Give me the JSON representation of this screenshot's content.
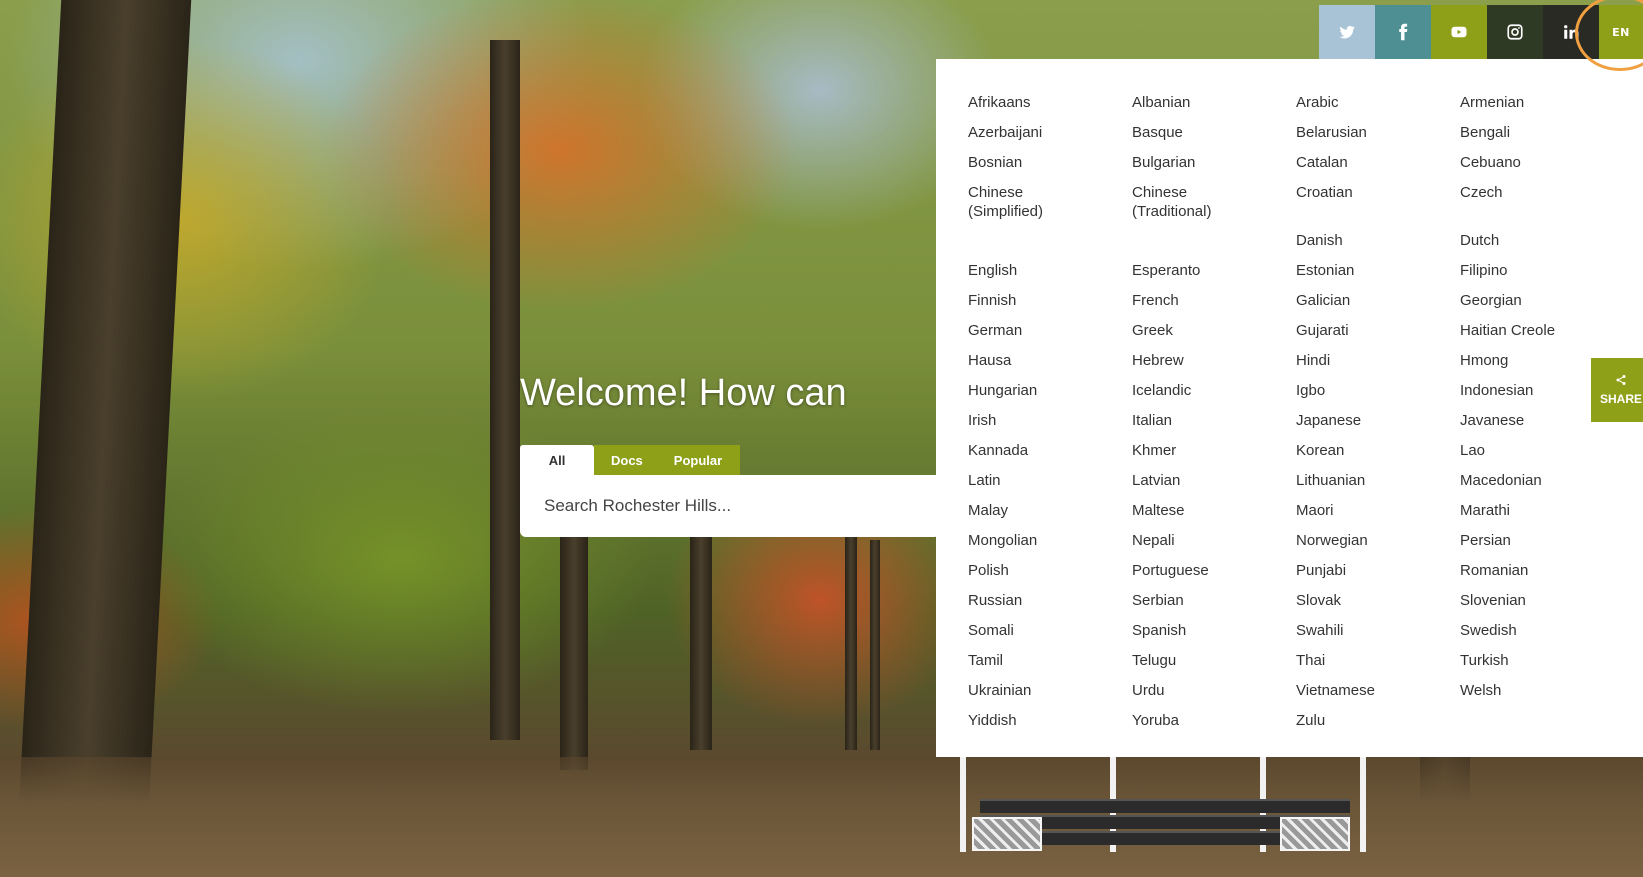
{
  "social": {
    "items": [
      {
        "name": "twitter-icon"
      },
      {
        "name": "facebook-icon"
      },
      {
        "name": "youtube-icon"
      },
      {
        "name": "instagram-icon"
      },
      {
        "name": "linkedin-icon"
      }
    ],
    "lang_button": "EN",
    "colors": {
      "accent": "#8ea018",
      "twitter": "#a9c3d6",
      "facebook": "#4e8f94",
      "highlight": "#f0a040"
    }
  },
  "hero": {
    "welcome": "Welcome! How can"
  },
  "search": {
    "tabs": [
      {
        "label": "All"
      },
      {
        "label": "Docs"
      },
      {
        "label": "Popular"
      }
    ],
    "placeholder": "Search Rochester Hills..."
  },
  "languages": [
    "Afrikaans",
    "Albanian",
    "Arabic",
    "Armenian",
    "Azerbaijani",
    "Basque",
    "Belarusian",
    "Bengali",
    "Bosnian",
    "Bulgarian",
    "Catalan",
    "Cebuano",
    "Chinese (Simplified)",
    "Chinese (Traditional)",
    "Croatian",
    "Czech",
    "",
    "",
    "Danish",
    "Dutch",
    "English",
    "Esperanto",
    "Estonian",
    "Filipino",
    "Finnish",
    "French",
    "Galician",
    "Georgian",
    "German",
    "Greek",
    "Gujarati",
    "Haitian Creole",
    "Hausa",
    "Hebrew",
    "Hindi",
    "Hmong",
    "Hungarian",
    "Icelandic",
    "Igbo",
    "Indonesian",
    "Irish",
    "Italian",
    "Japanese",
    "Javanese",
    "Kannada",
    "Khmer",
    "Korean",
    "Lao",
    "Latin",
    "Latvian",
    "Lithuanian",
    "Macedonian",
    "Malay",
    "Maltese",
    "Maori",
    "Marathi",
    "Mongolian",
    "Nepali",
    "Norwegian",
    "Persian",
    "Polish",
    "Portuguese",
    "Punjabi",
    "Romanian",
    "Russian",
    "Serbian",
    "Slovak",
    "Slovenian",
    "Somali",
    "Spanish",
    "Swahili",
    "Swedish",
    "Tamil",
    "Telugu",
    "Thai",
    "Turkish",
    "Ukrainian",
    "Urdu",
    "Vietnamese",
    "Welsh",
    "Yiddish",
    "Yoruba",
    "Zulu",
    ""
  ],
  "share": {
    "label": "SHARE"
  }
}
